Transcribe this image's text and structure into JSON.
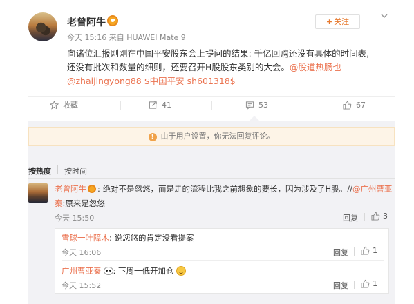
{
  "post": {
    "author": "老曾阿牛",
    "meta": "今天 15:16 来自 HUAWEI Mate 9",
    "follow_label": "关注",
    "follow_plus": "+",
    "text_line1": "向诸位汇报刚刚在中国平安股东会上提问的结果: 千亿回购还没有具体的时间表,",
    "text_line2_plain": "还没有批次和数量的细则，还要召开H股股东类别的大会。",
    "mention_1": "@股道热肠也",
    "mention_2": "@zhaijingyong88",
    "topic": "$中国平安 sh601318$"
  },
  "actions": {
    "favorite": "收藏",
    "forward_count": "41",
    "comment_count": "53",
    "like_count": "67"
  },
  "notice": "由于用户设置，你无法回复评论。",
  "sort": {
    "active": "按热度",
    "other": "按时间"
  },
  "comment": {
    "author": "老曾阿牛",
    "text_main": ": 绝对不是忽悠，而是走的流程比我之前想象的要长，因为涉及了H股。//",
    "mention": "@广州曹亚",
    "mention_cont": "秦",
    "text_tail": ":原来是忽悠",
    "time": "今天 15:50",
    "reply_label": "回复",
    "likes": "3"
  },
  "subcomments": [
    {
      "author": "雪球一叶障木",
      "text": ": 说您悠的肯定没看提案",
      "time": "今天 16:06",
      "reply_label": "回复",
      "likes": "1"
    },
    {
      "author": "广州曹亚秦",
      "text": ": 下周一低开加仓",
      "time": "今天 15:52",
      "reply_label": "回复",
      "likes": "1"
    }
  ],
  "colors": {
    "accent": "#eb7350",
    "follow": "#e77a2f",
    "panel": "#f2f2f5",
    "notice_bg": "#fdf4e7"
  },
  "icons": [
    "chevron-down-icon",
    "star-icon",
    "forward-icon",
    "comment-icon",
    "thumb-up-icon",
    "warning-icon",
    "verified-badge-icon",
    "panda-emoji-icon",
    "smile-emoji-icon"
  ]
}
